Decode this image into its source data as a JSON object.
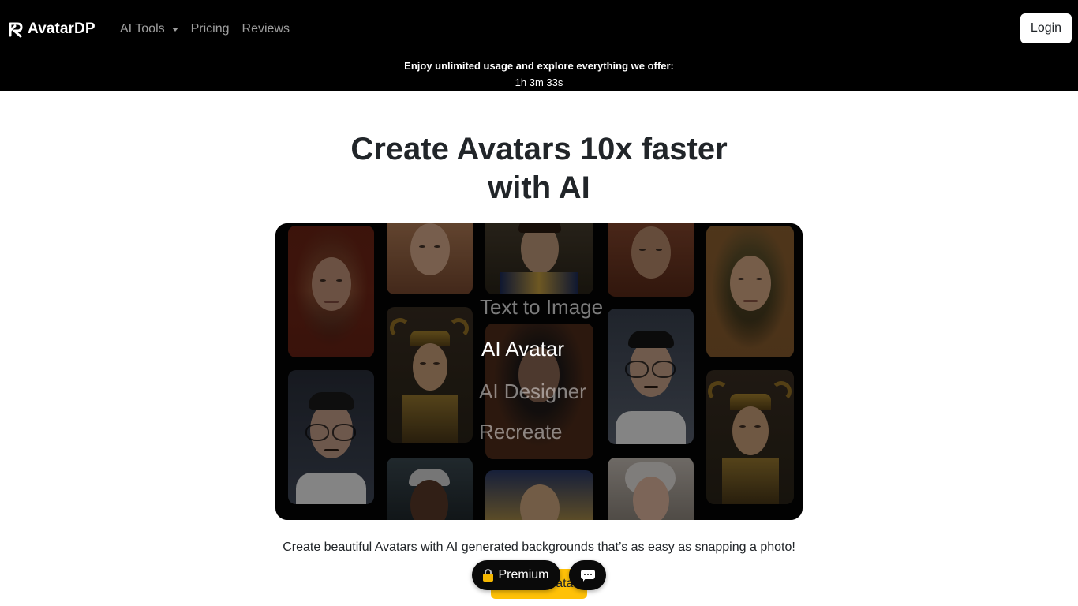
{
  "header": {
    "logo_text": "AvatarDP",
    "nav": {
      "ai_tools": "AI Tools",
      "pricing": "Pricing",
      "reviews": "Reviews"
    },
    "login": "Login",
    "promo_text": "Enjoy unlimited usage and explore everything we offer:",
    "promo_timer": "1h 3m 33s"
  },
  "hero": {
    "title_line1": "Create Avatars 10x faster",
    "title_line2": "with AI",
    "menu": [
      "Text to Image",
      "AI Avatar",
      "AI Designer",
      "Recreate"
    ],
    "active_menu": "AI Avatar",
    "tagline": "Create beautiful Avatars with AI generated backgrounds that’s as easy as snapping a photo!",
    "cta_label": "Create Avatar"
  },
  "floating": {
    "premium_label": "Premium"
  },
  "icons": {
    "logo": "avatardp-logo-icon",
    "dropdown": "caret-down-icon",
    "premium": "lock-icon",
    "chat": "chat-icon"
  },
  "colors": {
    "header_bg": "#000000",
    "cta_bg": "#ffc107",
    "showcase_bg": "#050505",
    "pill_bg": "#0a0a0a"
  }
}
